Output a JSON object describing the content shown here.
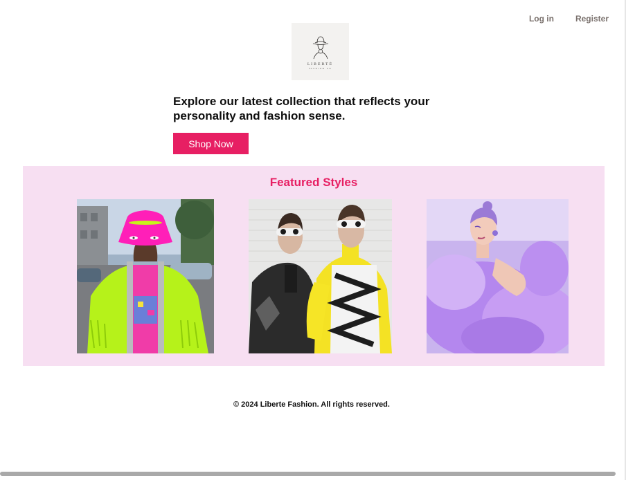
{
  "nav": {
    "login_label": "Log in",
    "register_label": "Register"
  },
  "logo": {
    "brand": "LIBERTÉ",
    "sub": "FASHION CO",
    "icon": "woman-in-hat-icon"
  },
  "hero": {
    "headline": "Explore our latest collection that reflects your personality and fashion sense.",
    "cta_label": "Shop Now"
  },
  "featured": {
    "title": "Featured Styles",
    "items": [
      {
        "name": "neon-jacket-style",
        "icon": "photo-neon-bucket-hat-green-fringe-jacket"
      },
      {
        "name": "monochrome-sunglasses-style",
        "icon": "photo-two-models-white-sunglasses"
      },
      {
        "name": "lilac-tulle-style",
        "icon": "photo-woman-lilac-tulle-dress"
      }
    ]
  },
  "footer": {
    "copyright": "© 2024 Liberte Fashion. All rights reserved."
  },
  "colors": {
    "accent": "#e71f63",
    "featured_bg": "#f7dff2",
    "nav_text": "#7a716d"
  }
}
